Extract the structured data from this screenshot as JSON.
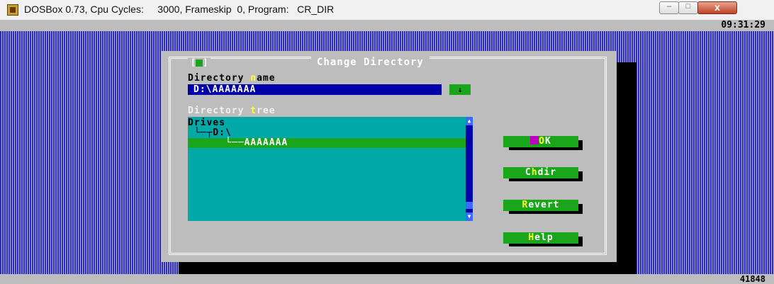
{
  "window": {
    "title": "DOSBox 0.73, Cpu Cycles:     3000, Frameskip  0, Program:   CR_DIR",
    "minimize_label": "–",
    "maximize_label": "□",
    "close_label": "x"
  },
  "status": {
    "clock": "09:31:29",
    "memory": "41848"
  },
  "dialog": {
    "close_box": "[■]",
    "title": "Change Directory",
    "dir_label_pre": "Directory ",
    "dir_label_hot": "n",
    "dir_label_post": "ame",
    "dir_value": "D:\\AAAAAAA",
    "dropdown_glyph": "↓",
    "tree_label_pre": "Directory ",
    "tree_label_hot": "t",
    "tree_label_post": "ree",
    "tree": [
      {
        "text": "Drives"
      },
      {
        "text": " └─┬D:\\"
      },
      {
        "text": "      └──AAAAAAA"
      }
    ],
    "scroll_up": "▲",
    "scroll_down": "▼",
    "buttons": {
      "ok_hot": "O",
      "ok_post": "K",
      "chdir_pre": "C",
      "chdir_hot": "h",
      "chdir_post": "dir",
      "revert_hot": "R",
      "revert_post": "evert",
      "help_hot": "H",
      "help_post": "elp"
    }
  },
  "colors": {
    "desktop_blue": "#2a2ab4",
    "dialog_gray": "#bdbdbd",
    "input_blue": "#0000a8",
    "tree_cyan": "#00a8a8",
    "button_green": "#1aa61a",
    "hotkey_yellow": "#ffff33"
  }
}
